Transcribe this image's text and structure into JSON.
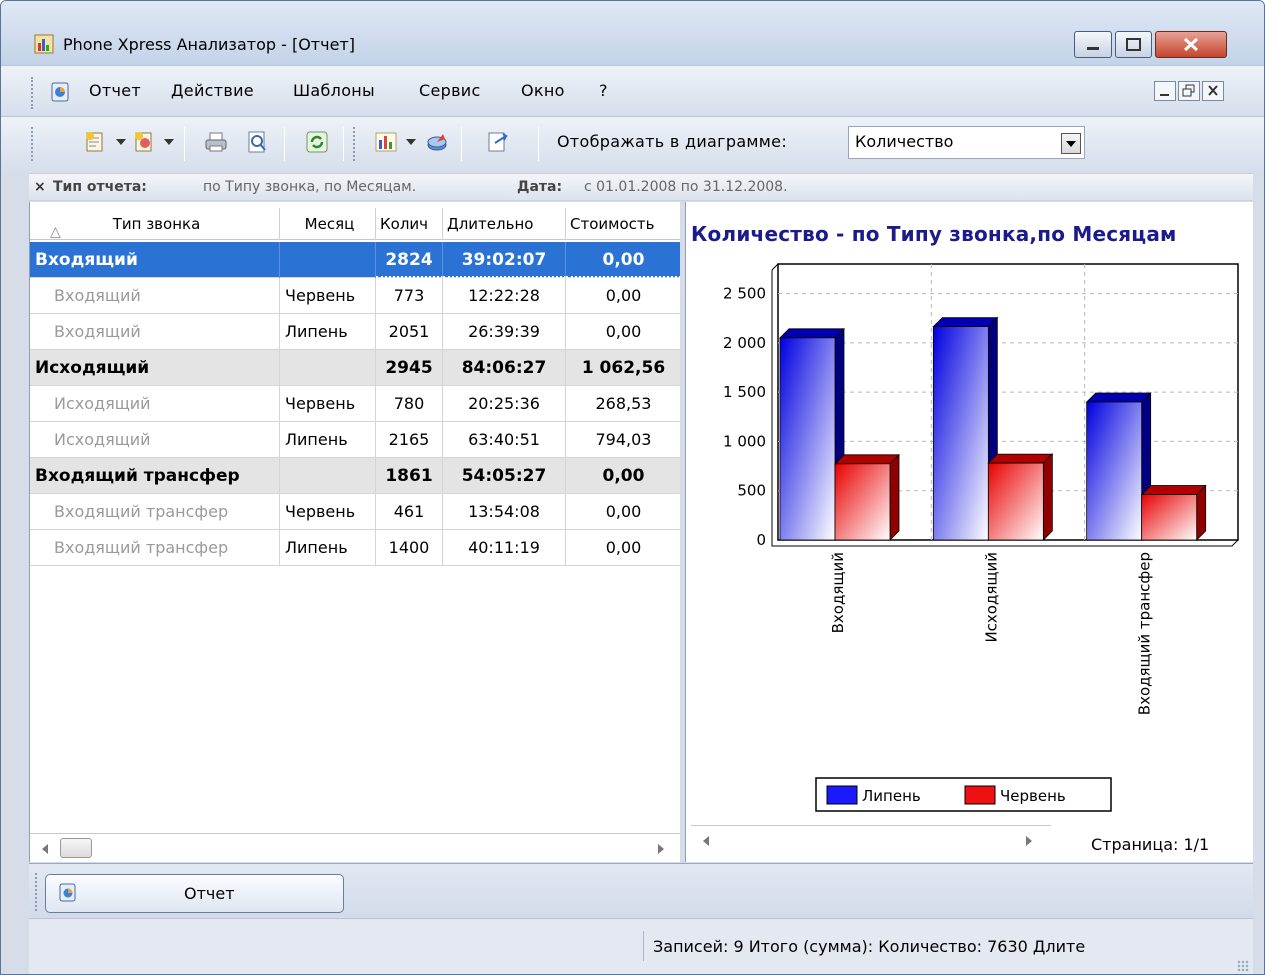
{
  "window": {
    "title": "Phone Xpress Анализатор - [Отчет]"
  },
  "menu": {
    "items": [
      "Отчет",
      "Действие",
      "Шаблоны",
      "Сервис",
      "Окно",
      "?"
    ]
  },
  "toolbar": {
    "chart_label": "Отображать в диаграмме:",
    "chart_select_value": "Количество"
  },
  "filter": {
    "close": "×",
    "type_label": "Тип отчета:",
    "type_value": "по Типу звонка, по Месяцам.",
    "date_label": "Дата:",
    "date_value": "с 01.01.2008 по 31.12.2008."
  },
  "table": {
    "sort_indicator": "△",
    "columns": [
      "Тип звонка",
      "Месяц",
      "Колич",
      "Длительно",
      "Стоимость"
    ],
    "rows": [
      {
        "kind": "sel",
        "type": "Входящий",
        "month": "",
        "qty": "2824",
        "dur": "39:02:07",
        "cost": "0,00"
      },
      {
        "kind": "detail",
        "type": "Входящий",
        "month": "Червень",
        "qty": "773",
        "dur": "12:22:28",
        "cost": "0,00"
      },
      {
        "kind": "detail",
        "type": "Входящий",
        "month": "Липень",
        "qty": "2051",
        "dur": "26:39:39",
        "cost": "0,00"
      },
      {
        "kind": "grp",
        "type": "Исходящий",
        "month": "",
        "qty": "2945",
        "dur": "84:06:27",
        "cost": "1 062,56"
      },
      {
        "kind": "detail",
        "type": "Исходящий",
        "month": "Червень",
        "qty": "780",
        "dur": "20:25:36",
        "cost": "268,53"
      },
      {
        "kind": "detail",
        "type": "Исходящий",
        "month": "Липень",
        "qty": "2165",
        "dur": "63:40:51",
        "cost": "794,03"
      },
      {
        "kind": "grp",
        "type": "Входящий трансфер",
        "month": "",
        "qty": "1861",
        "dur": "54:05:27",
        "cost": "0,00"
      },
      {
        "kind": "detail",
        "type": "Входящий трансфер",
        "month": "Червень",
        "qty": "461",
        "dur": "13:54:08",
        "cost": "0,00"
      },
      {
        "kind": "detail",
        "type": "Входящий трансфер",
        "month": "Липень",
        "qty": "1400",
        "dur": "40:11:19",
        "cost": "0,00"
      }
    ]
  },
  "chart_data": {
    "type": "bar",
    "title": "Количество - по Типу звонка,по Месяцам",
    "categories": [
      "Входящий",
      "Исходящий",
      "Входящий трансфер"
    ],
    "series": [
      {
        "name": "Липень",
        "values": [
          2051,
          2165,
          1400
        ],
        "color": "#1a1aff"
      },
      {
        "name": "Червень",
        "values": [
          773,
          780,
          461
        ],
        "color": "#ee1111"
      }
    ],
    "yticks": [
      "0",
      "500",
      "1 000",
      "1 500",
      "2 000",
      "2 500"
    ],
    "ylim": [
      0,
      2800
    ],
    "grid": true,
    "legend_position": "bottom"
  },
  "chart_footer": {
    "page": "Страница: 1/1"
  },
  "tabs": [
    {
      "label": "Отчет"
    }
  ],
  "status": {
    "text": "Записей: 9  Итого (сумма):  Количество: 7630  Длите"
  }
}
